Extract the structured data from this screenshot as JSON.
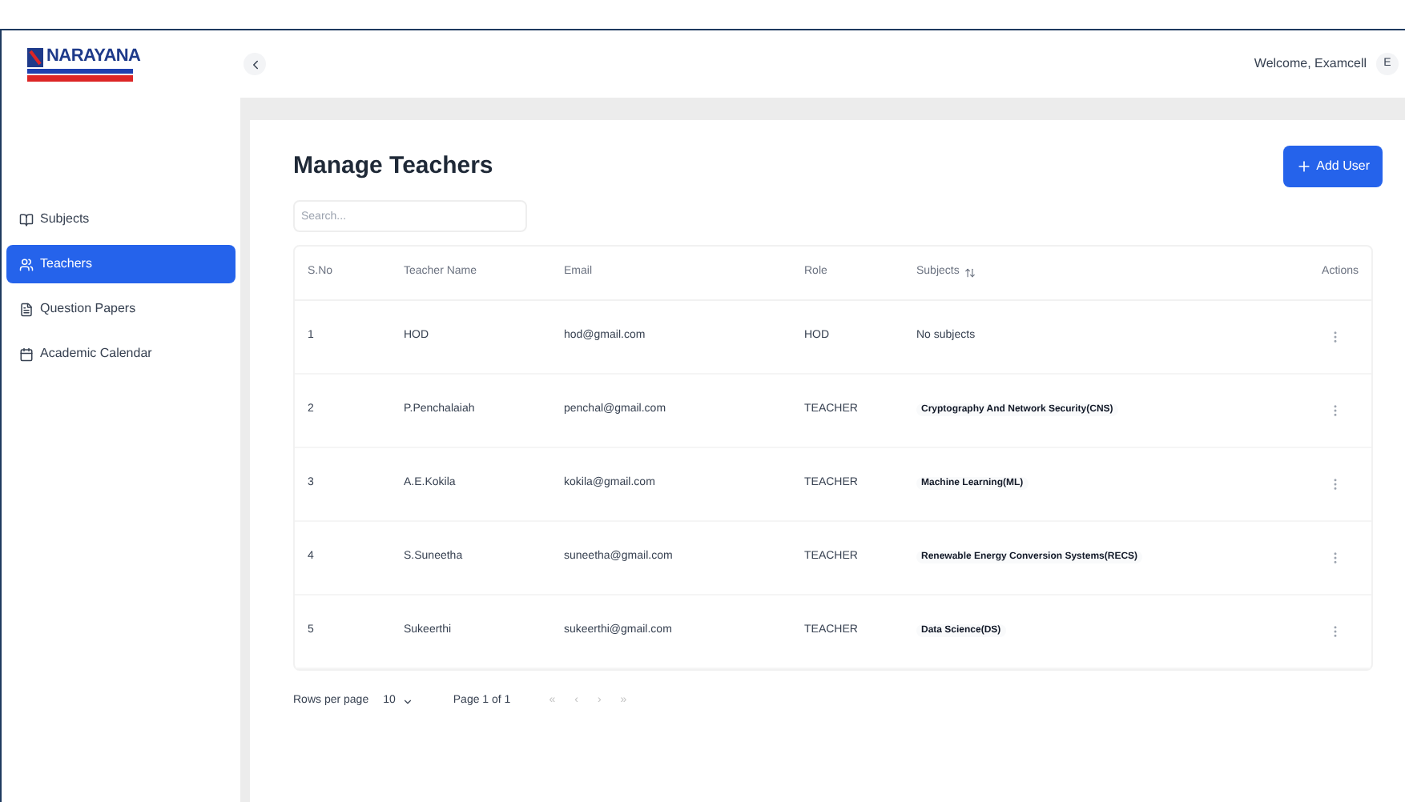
{
  "logo": {
    "name": "NARAYANA"
  },
  "header": {
    "welcome": "Welcome, Examcell",
    "avatar": "E"
  },
  "sidebar": {
    "items": [
      {
        "label": "Subjects",
        "selected": false
      },
      {
        "label": "Teachers",
        "selected": true
      },
      {
        "label": "Question Papers",
        "selected": false
      },
      {
        "label": "Academic Calendar",
        "selected": false
      }
    ]
  },
  "page": {
    "title": "Manage Teachers",
    "add_button": "Add User",
    "search": {
      "placeholder": "Search..."
    }
  },
  "table": {
    "columns": [
      "S.No",
      "Teacher Name",
      "Email",
      "Role",
      "Subjects",
      "Actions"
    ],
    "rows": [
      {
        "sno": "1",
        "name": "HOD",
        "email": "hod@gmail.com",
        "role": "HOD",
        "subjects": {
          "kind": "none",
          "text": "No subjects"
        }
      },
      {
        "sno": "2",
        "name": "P.Penchalaiah",
        "email": "penchal@gmail.com",
        "role": "TEACHER",
        "subjects": {
          "kind": "chip",
          "text": "Cryptography And Network Security(CNS)"
        }
      },
      {
        "sno": "3",
        "name": "A.E.Kokila",
        "email": "kokila@gmail.com",
        "role": "TEACHER",
        "subjects": {
          "kind": "chip",
          "text": "Machine Learning(ML)"
        }
      },
      {
        "sno": "4",
        "name": "S.Suneetha",
        "email": "suneetha@gmail.com",
        "role": "TEACHER",
        "subjects": {
          "kind": "chip",
          "text": "Renewable Energy Conversion Systems(RECS)"
        }
      },
      {
        "sno": "5",
        "name": "Sukeerthi",
        "email": "sukeerthi@gmail.com",
        "role": "TEACHER",
        "subjects": {
          "kind": "chip",
          "text": "Data Science(DS)"
        }
      }
    ]
  },
  "pagination": {
    "rows_label": "Rows per page",
    "rows_value": "10",
    "page_label": "Page 1 of 1",
    "buttons": [
      "«",
      "‹",
      "›",
      "»"
    ]
  }
}
